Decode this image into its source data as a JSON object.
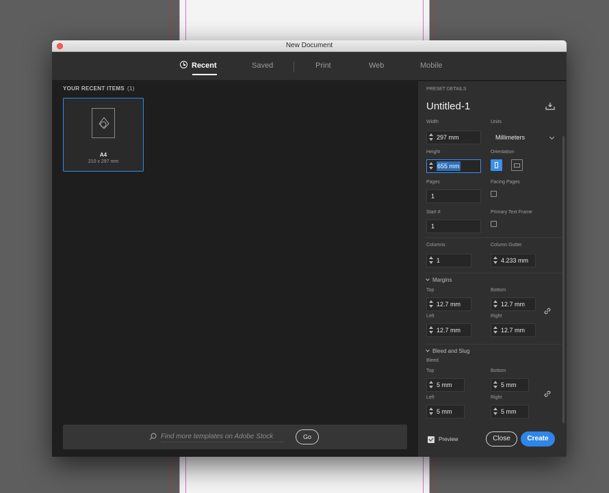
{
  "window": {
    "title": "New Document"
  },
  "tabs": [
    {
      "label": "Recent",
      "active": true
    },
    {
      "label": "Saved",
      "active": false
    },
    {
      "label": "Print",
      "active": false
    },
    {
      "label": "Web",
      "active": false
    },
    {
      "label": "Mobile",
      "active": false
    }
  ],
  "recent": {
    "heading": "YOUR RECENT ITEMS",
    "count": "(1)",
    "items": [
      {
        "name": "A4",
        "size": "210 x 297 mm"
      }
    ]
  },
  "search": {
    "placeholder": "Find more templates on Adobe Stock",
    "go_label": "Go"
  },
  "preset": {
    "heading": "PRESET DETAILS",
    "name": "Untitled-1",
    "width_label": "Width",
    "width_value": "297 mm",
    "units_label": "Units",
    "units_value": "Millimeters",
    "height_label": "Height",
    "height_value": "655 mm",
    "orientation_label": "Orientation",
    "pages_label": "Pages",
    "pages_value": "1",
    "facing_label": "Facing Pages",
    "start_label": "Start #",
    "start_value": "1",
    "primary_label": "Primary Text Frame",
    "columns_label": "Columns",
    "columns_value": "1",
    "gutter_label": "Column Gutter",
    "gutter_value": "4.233 mm",
    "margins": {
      "label": "Margins",
      "top_label": "Top",
      "top_value": "12.7 mm",
      "bottom_label": "Bottom",
      "bottom_value": "12.7 mm",
      "left_label": "Left",
      "left_value": "12.7 mm",
      "right_label": "Right",
      "right_value": "12.7 mm"
    },
    "bleed": {
      "section_label": "Bleed and Slug",
      "label": "Bleed",
      "top_label": "Top",
      "top_value": "5 mm",
      "bottom_label": "Bottom",
      "bottom_value": "5 mm",
      "left_label": "Left",
      "left_value": "5 mm",
      "right_label": "Right",
      "right_value": "5 mm"
    }
  },
  "footer": {
    "preview_label": "Preview",
    "close_label": "Close",
    "create_label": "Create"
  },
  "colors": {
    "accent": "#2f86e8",
    "panel": "#2f2f2f",
    "left_panel": "#1e1e1e"
  }
}
